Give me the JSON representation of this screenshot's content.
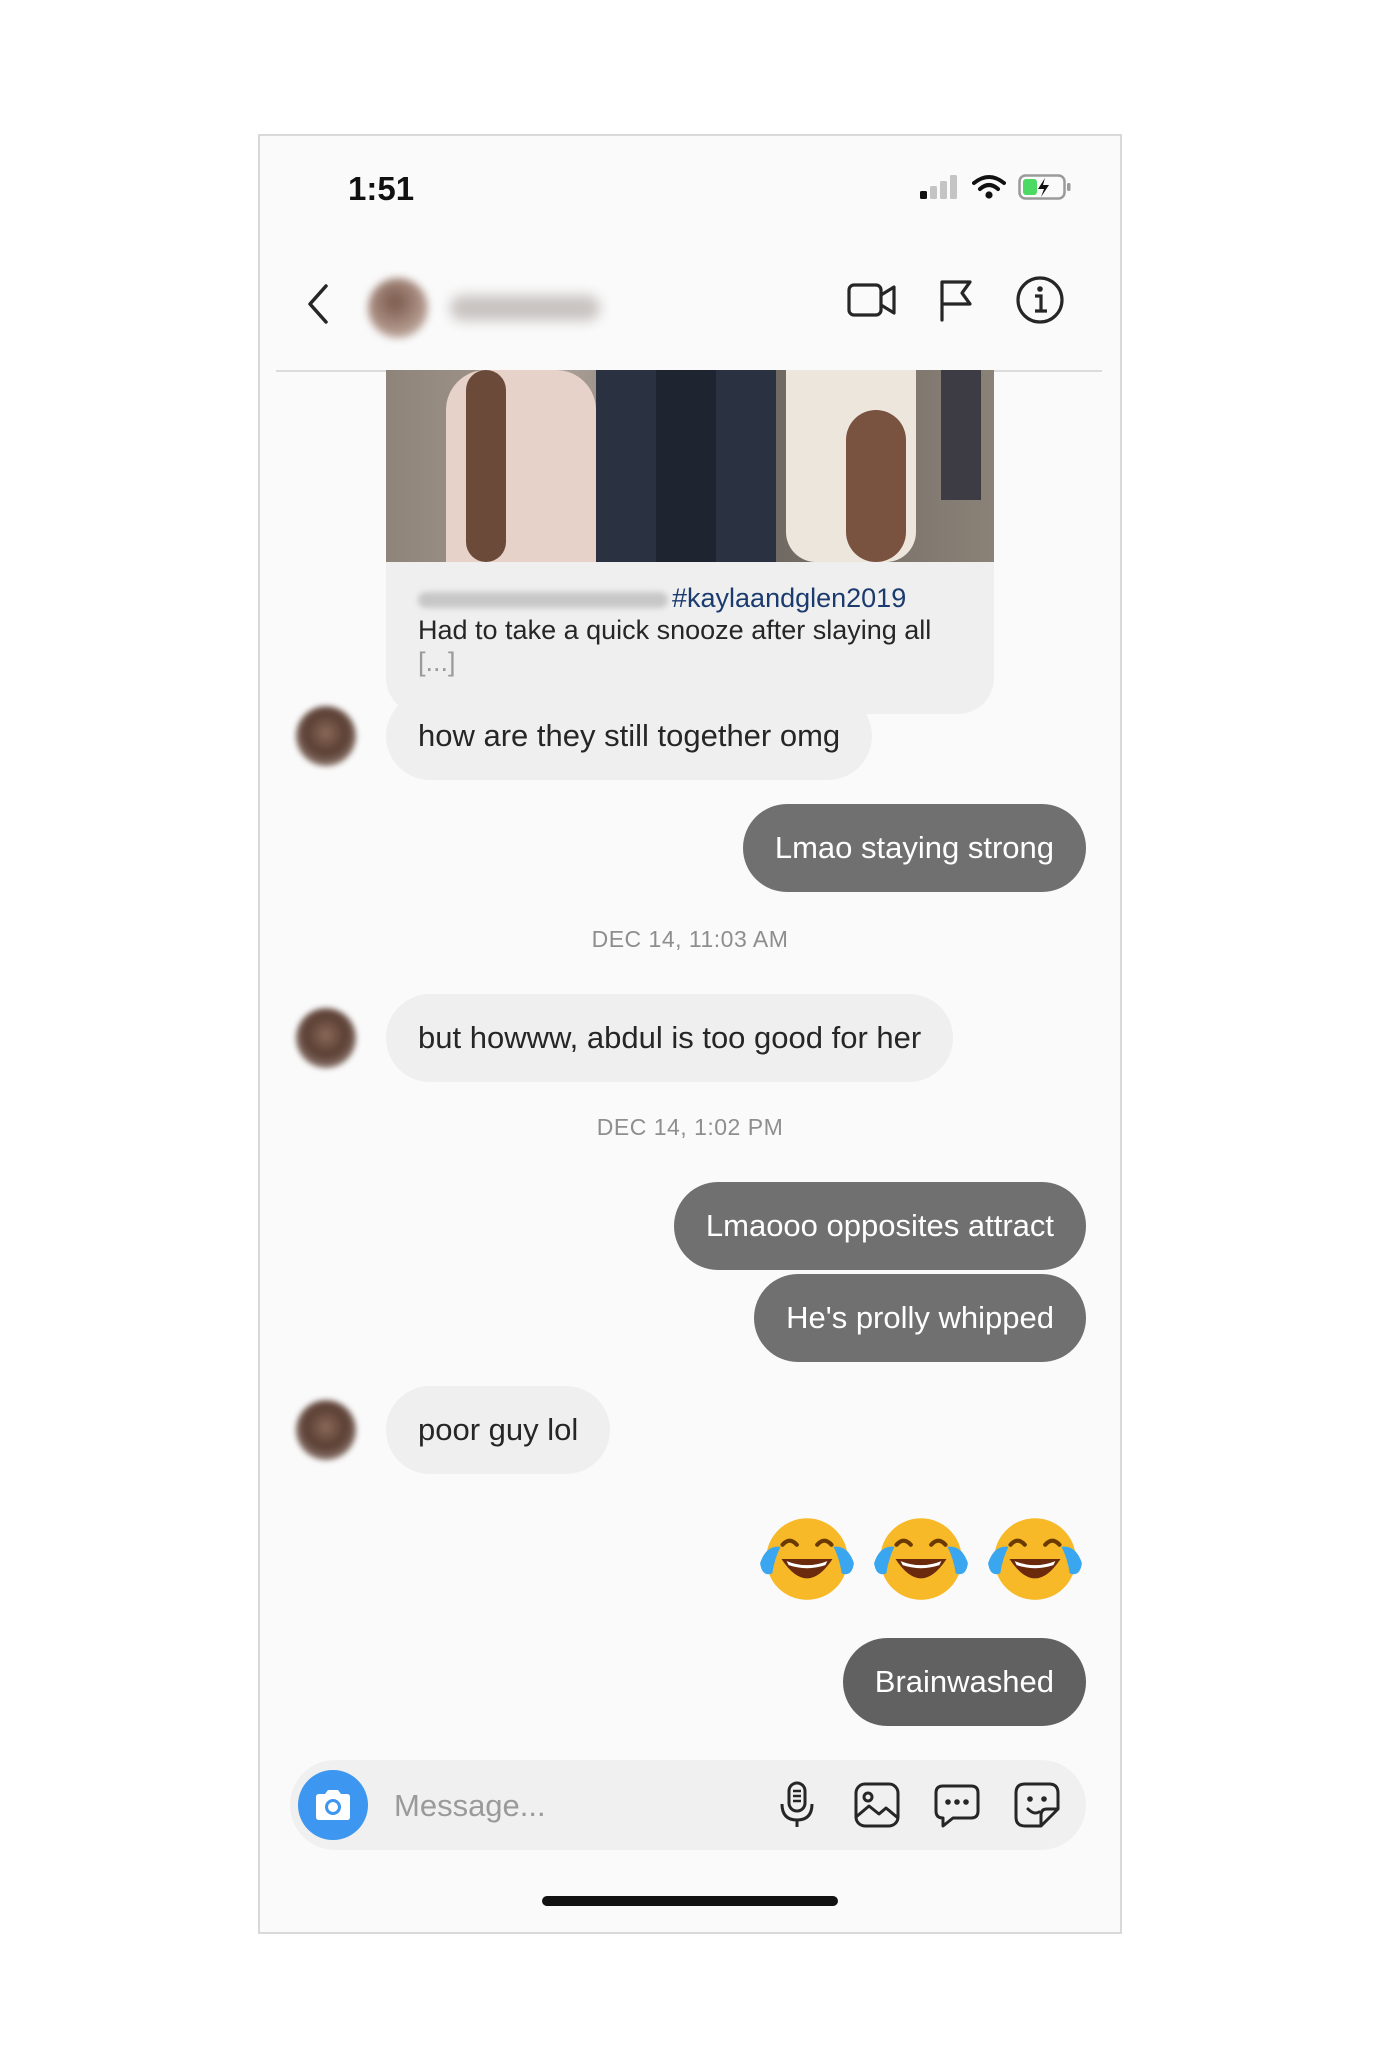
{
  "status_bar": {
    "time": "1:51"
  },
  "header": {
    "contact_name": "",
    "icons": [
      "back-icon",
      "video-call-icon",
      "flag-icon",
      "info-icon"
    ]
  },
  "shared_post": {
    "hashtag": "#kaylaandglen2019",
    "caption": "Had to take a quick snooze after slaying all",
    "more": "[...]"
  },
  "messages": [
    {
      "side": "in",
      "text": "how are they still together omg"
    },
    {
      "side": "out",
      "text": "Lmao staying strong"
    },
    {
      "timestamp": "DEC 14, 11:03 AM"
    },
    {
      "side": "in",
      "text": "but howww, abdul is too good for her"
    },
    {
      "timestamp": "DEC 14, 1:02 PM"
    },
    {
      "side": "out",
      "text": "Lmaooo opposites attract"
    },
    {
      "side": "out",
      "text": "He's prolly whipped"
    },
    {
      "side": "in",
      "text": "poor guy lol"
    },
    {
      "side": "out",
      "emoji": "face-with-tears-of-joy x3"
    },
    {
      "side": "out",
      "text": "Brainwashed"
    }
  ],
  "composer": {
    "placeholder": "Message...",
    "icons": [
      "camera-icon",
      "microphone-icon",
      "gallery-icon",
      "chat-bubble-icon",
      "sticker-icon"
    ]
  },
  "colors": {
    "outgoing_bubble": "#707070",
    "incoming_bubble": "#efefef",
    "camera_button": "#3d96f0",
    "hashtag": "#1b3b6f",
    "battery_green": "#4cd964"
  }
}
